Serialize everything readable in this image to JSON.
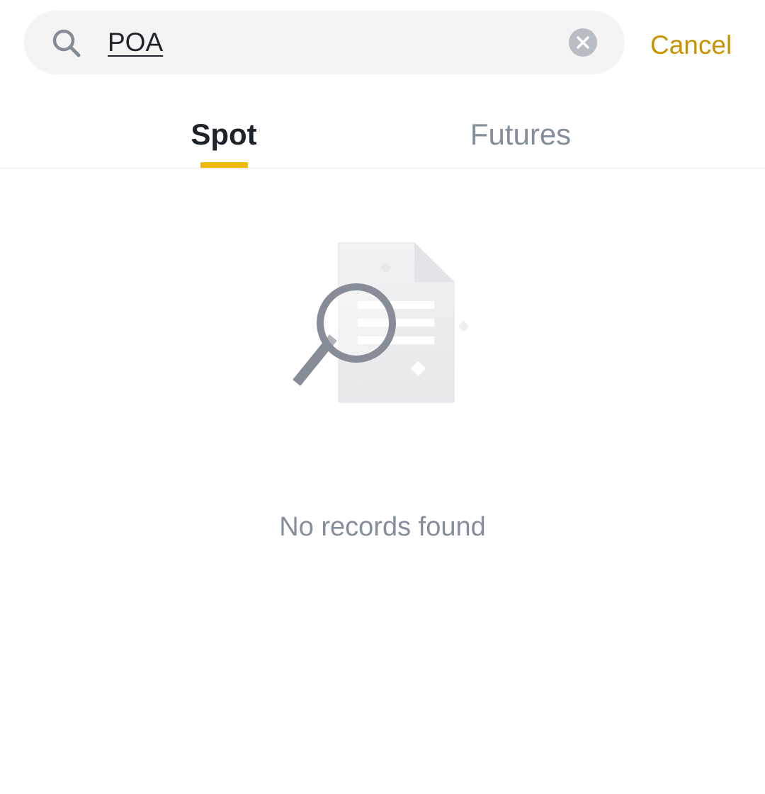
{
  "search": {
    "query": "POA",
    "cancel_label": "Cancel",
    "search_icon": "search-icon",
    "clear_icon": "clear-circle-icon"
  },
  "tabs": [
    {
      "label": "Spot",
      "active": true
    },
    {
      "label": "Futures",
      "active": false
    }
  ],
  "empty_state": {
    "icon": "document-search-icon",
    "message": "No records found"
  },
  "colors": {
    "accent": "#f0b90b",
    "cancel_text": "#c99400",
    "active_tab_text": "#1e2329",
    "inactive_tab_text": "#848e9c",
    "search_bg": "#f4f4f4"
  }
}
